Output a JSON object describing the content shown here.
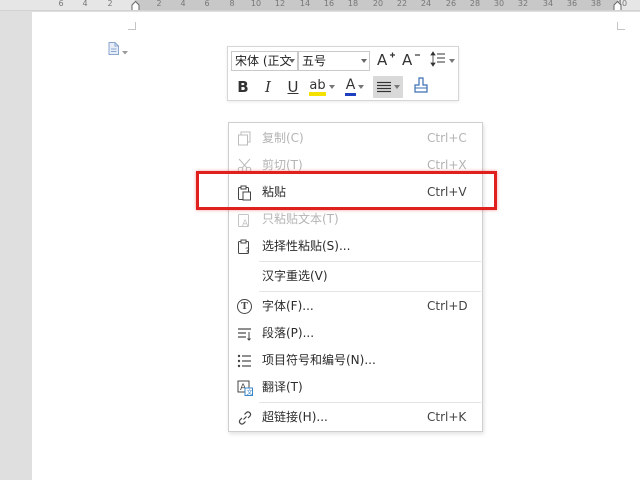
{
  "ruler": {
    "labels": [
      "6",
      "4",
      "2",
      "2",
      "4",
      "6",
      "8",
      "10",
      "12",
      "14",
      "16",
      "18",
      "20",
      "22",
      "24",
      "26",
      "28",
      "30",
      "32",
      "34",
      "36",
      "38",
      "40"
    ]
  },
  "mini_toolbar": {
    "font_name": "宋体 (正文",
    "font_size": "五号",
    "grow_font_icon": "A+",
    "shrink_font_icon": "A-",
    "bold_label": "B",
    "italic_label": "I",
    "underline_label": "U",
    "highlight_label": "ab",
    "font_color_label": "A",
    "highlight_color": "#f5e100",
    "font_color": "#1e3fbf"
  },
  "context_menu": {
    "items": [
      {
        "label": "复制(C)",
        "shortcut": "Ctrl+C",
        "icon": "copy-icon",
        "enabled": false
      },
      {
        "label": "剪切(T)",
        "shortcut": "Ctrl+X",
        "icon": "scissors-icon",
        "enabled": false
      },
      {
        "label": "粘贴",
        "shortcut": "Ctrl+V",
        "icon": "paste-icon",
        "enabled": true
      },
      {
        "label": "只粘贴文本(T)",
        "shortcut": "",
        "icon": "paste-text-icon",
        "enabled": false
      },
      {
        "label": "选择性粘贴(S)...",
        "shortcut": "",
        "icon": "paste-special-icon",
        "enabled": true
      },
      {
        "label": "汉字重选(V)",
        "shortcut": "",
        "icon": "",
        "enabled": true
      },
      {
        "label": "字体(F)...",
        "shortcut": "Ctrl+D",
        "icon": "font-icon",
        "enabled": true
      },
      {
        "label": "段落(P)...",
        "shortcut": "",
        "icon": "paragraph-icon",
        "enabled": true
      },
      {
        "label": "项目符号和编号(N)...",
        "shortcut": "",
        "icon": "bullet-list-icon",
        "enabled": true
      },
      {
        "label": "翻译(T)",
        "shortcut": "",
        "icon": "translate-icon",
        "enabled": true
      },
      {
        "label": "超链接(H)...",
        "shortcut": "Ctrl+K",
        "icon": "hyperlink-icon",
        "enabled": true
      }
    ]
  },
  "colors": {
    "highlight_box": "#e0201c"
  }
}
